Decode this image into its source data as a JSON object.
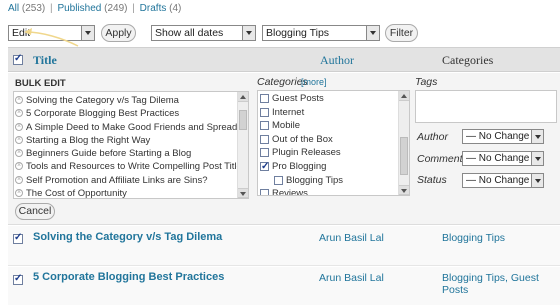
{
  "status_links": {
    "all": "All",
    "all_count": "(253)",
    "published": "Published",
    "published_count": "(249)",
    "drafts": "Drafts",
    "drafts_count": "(4)",
    "separator": "|"
  },
  "filters": {
    "bulk_action": "Edit",
    "apply_label": "Apply",
    "dates": "Show all dates",
    "category": "Blogging Tips",
    "filter_label": "Filter"
  },
  "table": {
    "col_title": "Title",
    "col_author": "Author",
    "col_categories": "Categories"
  },
  "bulk_edit": {
    "heading": "BULK EDIT",
    "posts": [
      "Solving the Category v/s Tag Dilema",
      "5 Corporate Blogging Best Practices",
      "A Simple Deed to Make Good Friends and Spread Joy",
      "Starting a Blog the Right Way",
      "Beginners Guide before Starting a Blog",
      "Tools and Resources to Write Compelling Post Titles",
      "Self Promotion and Affiliate Links are Sins?",
      "The Cost of Opportunity"
    ],
    "remove_glyph": "×",
    "categories_label": "Categories",
    "more_link": "[more]",
    "categories": [
      {
        "name": "Guest Posts",
        "checked": false,
        "child": false
      },
      {
        "name": "Internet",
        "checked": false,
        "child": false
      },
      {
        "name": "Mobile",
        "checked": false,
        "child": false
      },
      {
        "name": "Out of the Box",
        "checked": false,
        "child": false
      },
      {
        "name": "Plugin Releases",
        "checked": false,
        "child": false
      },
      {
        "name": "Pro Blogging",
        "checked": true,
        "child": false
      },
      {
        "name": "Blogging Tips",
        "checked": false,
        "child": true
      },
      {
        "name": "Reviews",
        "checked": false,
        "child": false
      }
    ],
    "tags_label": "Tags",
    "author_label": "Author",
    "comments_label": "Comments",
    "status_label": "Status",
    "author_value": "— No Change —",
    "comments_value": "— No Change —",
    "status_value": "— No Change —",
    "cancel_label": "Cancel"
  },
  "rows": [
    {
      "title": "Solving the Category v/s Tag Dilema",
      "author": "Arun Basil Lal",
      "categories": "Blogging Tips"
    },
    {
      "title": "5 Corporate Blogging Best Practices",
      "author": "Arun Basil Lal",
      "categories": "Blogging Tips, Guest Posts"
    }
  ],
  "colors": {
    "link": "#21759b",
    "header_bg": "#e3e3e3",
    "panel_bg": "#f4f4f4",
    "annotation": "#f0d78c"
  }
}
